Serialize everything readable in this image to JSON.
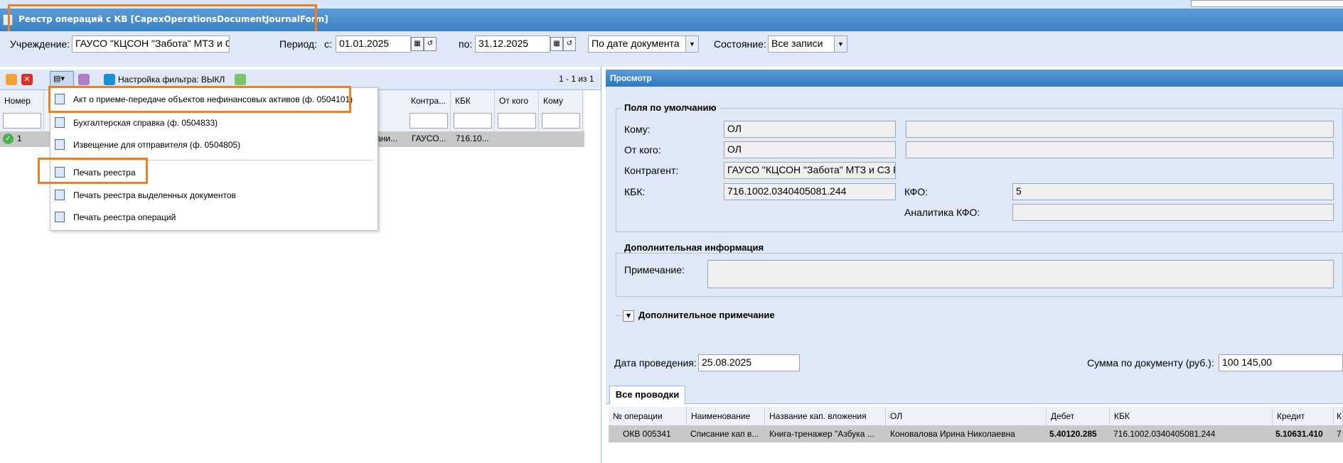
{
  "window": {
    "title": "Реестр операций с КВ [CapexOperationsDocumentJournalForm]"
  },
  "filter": {
    "institution_label": "Учреждение:",
    "institution_value": "ГАУСО \"КЦСОН \"Забота\" МТЗ и СЗ",
    "period_label": "Период:",
    "from_label": "с:",
    "from_value": "01.01.2025",
    "to_label": "по:",
    "to_value": "31.12.2025",
    "date_mode": "По дате документа",
    "state_label": "Состояние:",
    "state_value": "Все записи"
  },
  "toolbar": {
    "filter_setting": "Настройка фильтра: ВЫКЛ",
    "paging": "1 - 1 из 1"
  },
  "grid": {
    "columns": [
      "Номер",
      "Контра...",
      "КБК",
      "От кого",
      "Кому"
    ],
    "row": {
      "num": "1",
      "partial": "гани...",
      "contractor": "ГАУСО...",
      "kbk": "716.10..."
    }
  },
  "print_menu": {
    "items": [
      "Акт о приеме-передаче объектов нефинансовых активов (ф. 0504101)",
      "Бухгалтерская справка (ф. 0504833)",
      "Извещение для отправителя (ф. 0504805)",
      "Печать реестра",
      "Печать реестра выделенных документов",
      "Печать реестра операций"
    ]
  },
  "view": {
    "title": "Просмотр",
    "defaults_legend": "Поля по умолчанию",
    "to_label": "Кому:",
    "to_value": "ОЛ",
    "from_label": "От кого:",
    "from_value": "ОЛ",
    "contractor_label": "Контрагент:",
    "contractor_value": "ГАУСО \"КЦСОН \"Забота\" МТЗ и СЗ РТ",
    "kbk_label": "КБК:",
    "kbk_value": "716.1002.0340405081.244",
    "kfo_label": "КФО:",
    "kfo_value": "5",
    "kfo_analytics_label": "Аналитика КФО:",
    "kfo_analytics_value": "",
    "extra_legend": "Дополнительная информация",
    "note_label": "Примечание:",
    "note_value": "",
    "extra_note_legend": "Дополнительное примечание",
    "posting_date_label": "Дата проведения:",
    "posting_date_value": "25.08.2025",
    "sum_label": "Сумма по документу (руб.):",
    "sum_value": "100 145,00"
  },
  "entries": {
    "tab": "Все проводки",
    "columns": [
      "№ операции",
      "Наименование",
      "Название кап. вложения",
      "ОЛ",
      "Дебет",
      "КБК",
      "Кредит",
      "К"
    ],
    "row": [
      "ОКВ 005341",
      "Списание кап в...",
      "Книга-тренажер \"Азбука ...",
      "Коновалова Ирина Николаевна",
      "5.40120.285",
      "716.1002.0340405081.244",
      "5.10631.410",
      "7"
    ]
  }
}
